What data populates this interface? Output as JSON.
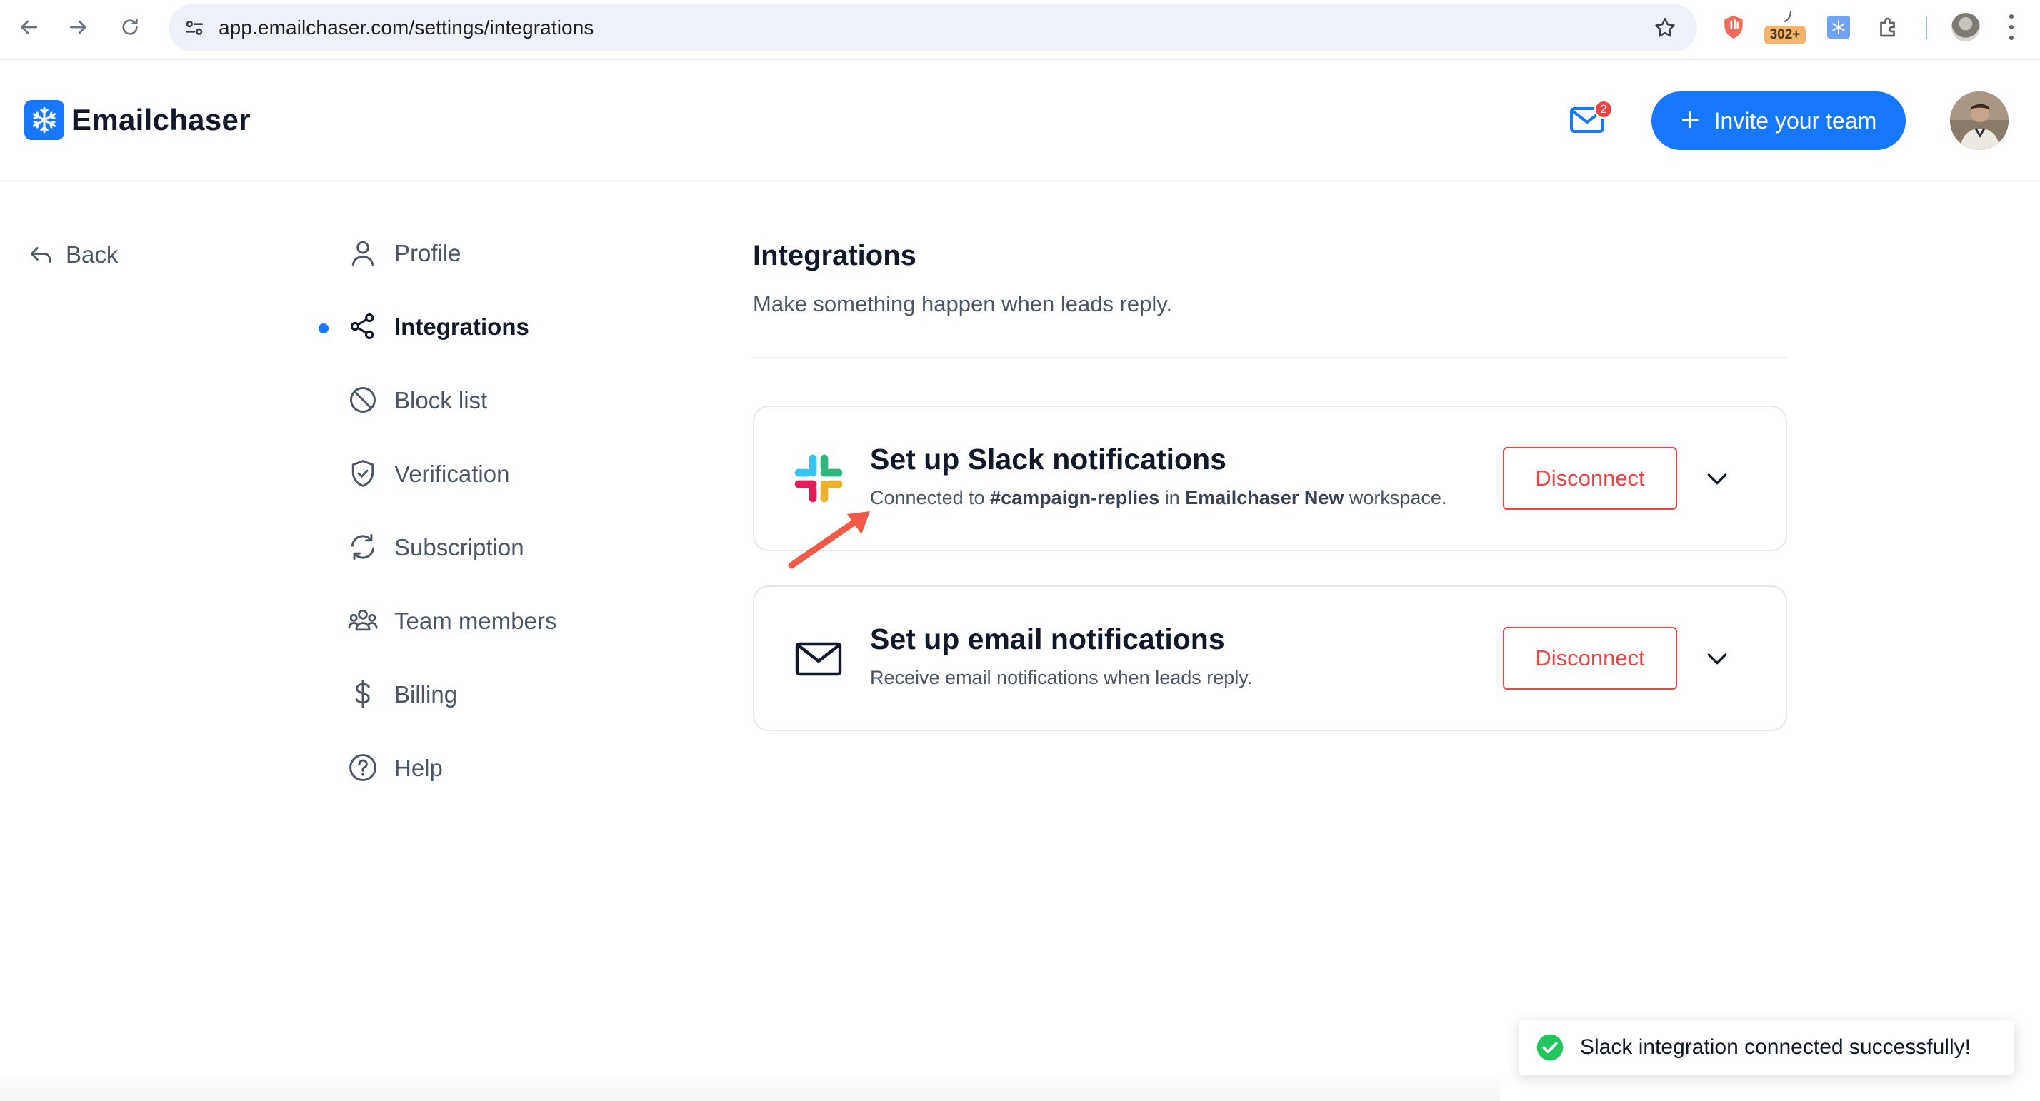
{
  "browser": {
    "url": "app.emailchaser.com/settings/integrations",
    "extension_badge": "302+"
  },
  "header": {
    "brand": "Emailchaser",
    "mail_badge_count": "2",
    "invite_label": "Invite your team",
    "accent_color": "#1677ff"
  },
  "back": {
    "label": "Back"
  },
  "nav": {
    "items": [
      {
        "label": "Profile",
        "icon": "user-icon"
      },
      {
        "label": "Integrations",
        "icon": "share-icon",
        "active": true
      },
      {
        "label": "Block list",
        "icon": "block-icon"
      },
      {
        "label": "Verification",
        "icon": "shield-check-icon"
      },
      {
        "label": "Subscription",
        "icon": "refresh-icon"
      },
      {
        "label": "Team members",
        "icon": "team-icon"
      },
      {
        "label": "Billing",
        "icon": "dollar-icon"
      },
      {
        "label": "Help",
        "icon": "help-icon"
      }
    ]
  },
  "main": {
    "title": "Integrations",
    "subtitle": "Make something happen when leads reply.",
    "cards": [
      {
        "title": "Set up Slack notifications",
        "desc_prefix": "Connected to ",
        "desc_channel": "#campaign-replies",
        "desc_mid": " in ",
        "desc_workspace": "Emailchaser New",
        "desc_suffix": " workspace.",
        "button": "Disconnect",
        "icon": "slack-icon"
      },
      {
        "title": "Set up email notifications",
        "desc": "Receive email notifications when leads reply.",
        "button": "Disconnect",
        "icon": "envelope-icon"
      }
    ]
  },
  "toast": {
    "message": "Slack integration connected successfully!",
    "color": "#22c55e"
  }
}
